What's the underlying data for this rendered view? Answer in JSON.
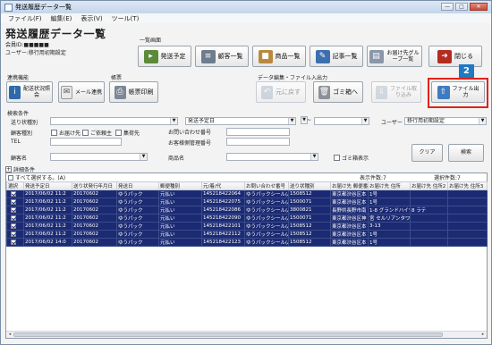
{
  "window": {
    "title": "発送履歴データ一覧",
    "controls": [
      "—",
      "□",
      "✕"
    ]
  },
  "menu": [
    "ファイル(F)",
    "編集(E)",
    "表示(V)",
    "ツール(T)"
  ],
  "page": {
    "title": "発送履歴データ一覧",
    "member_id": "会員ID:■■■■■",
    "user": "ユーザー:移行用初期設定"
  },
  "groups": {
    "ichiran": "一覧画面",
    "renkei": "連携機能",
    "chohyo": "帳票",
    "data_edit": "データ編集・ファイル入出力",
    "kensaku": "検索条件"
  },
  "buttons": {
    "hasso_yotei": "発送予定",
    "kokyaku": "顧客一覧",
    "shohin": "商品一覧",
    "kiji": "記事一覧",
    "otodoke_group": "お届け先グループ一覧",
    "close": "閉じる",
    "haisou_joukyou": "配送状況照会",
    "mail_renkei": "メール連携",
    "chohyo_insatsu": "帳票印刷",
    "moto_ni_modosu": "元に戻す",
    "gomibako": "ゴミ箱へ",
    "file_torikomi": "ファイル取り込み",
    "file_shutsuryoku": "ファイル出力",
    "clear": "クリア",
    "search": "検索"
  },
  "badge": "2",
  "search": {
    "okurijo_label": "送り状種別",
    "okurijo_value": "",
    "date_type_value": "発送予定日",
    "date_sep": "~",
    "user_label": "ユーザー",
    "user_value": "移行用初期設定",
    "kokyaku_shubetsu_label": "顧客種別",
    "chk_otodoke": "お届け先",
    "chk_irainushi": "ご依頼主",
    "chk_shuka": "集荷先",
    "toiawase_label": "お問い合わせ番号",
    "kokyaku_kanri_label": "お客様側管理番号",
    "tel_label": "TEL",
    "kokyakumei_label": "顧客名",
    "shohinmei_label": "商品名",
    "gomibako_hyoji": "ゴミ箱表示"
  },
  "detail_toggle": "詳細条件",
  "list": {
    "select_all": "すべて選択する。(A)",
    "display_count": "表示件数:7",
    "selected_count": "選択件数:7",
    "columns": [
      "選択",
      "発送予定日",
      "送り状発行年月日",
      "発送日",
      "郵便種別",
      "元/着/代",
      "お問い合わせ番号",
      "送り状種別",
      "お届け先 郵便番号",
      "お届け先 住所",
      "お届け先 住所2",
      "お届け先 住所3"
    ],
    "rows": [
      [
        "",
        "2017/06/02 11:2",
        "20170602",
        "ゆうパック",
        "元払い",
        "145218422064",
        "ゆうパックシール(A",
        "1508512",
        "東京都渋谷区本",
        "1号",
        "",
        ""
      ],
      [
        "",
        "2017/06/02 11:2",
        "20170602",
        "ゆうパック",
        "元払い",
        "145218422075",
        "ゆうパックシール(A",
        "1500071",
        "東京都渋谷区本",
        "1号",
        "",
        ""
      ],
      [
        "",
        "2017/06/02 11:2",
        "20170602",
        "ゆうパック",
        "元払い",
        "145218422086",
        "ゆうパックシール(A",
        "3800821",
        "長野県長野市南",
        "1-8 グランドハイツ",
        "8 ラテ",
        ""
      ],
      [
        "",
        "2017/06/02 11:2",
        "20170602",
        "ゆうパック",
        "元払い",
        "145218422090",
        "ゆうパックシール(A",
        "1500071",
        "東京都渋谷区神",
        "宮 セルリアンタワー",
        "",
        ""
      ],
      [
        "",
        "2017/06/02 11:2",
        "20170602",
        "ゆうパック",
        "元払い",
        "145218422101",
        "ゆうパックシール(A",
        "1508512",
        "東京都渋谷区本",
        "3-13",
        "",
        ""
      ],
      [
        "",
        "2017/06/02 11:2",
        "20170602",
        "ゆうパック",
        "元払い",
        "145218422112",
        "ゆうパックシール(A",
        "1508512",
        "東京都渋谷区本",
        "1号",
        "",
        ""
      ],
      [
        "",
        "2017/06/02 14:0",
        "20170602",
        "ゆうパック",
        "元払い",
        "145218422123",
        "ゆうパックシール(A",
        "1508512",
        "東京都渋谷区本",
        "1号",
        "",
        ""
      ]
    ]
  },
  "colors": {
    "accent_red": "#e0231a",
    "badge_blue": "#1f79c4",
    "row_selected": "#1c2a73"
  },
  "icons": {
    "hasso_yotei": "truck-icon",
    "kokyaku": "person-list-icon",
    "shohin": "box-icon",
    "kiji": "notebook-icon",
    "otodoke_group": "document-icon",
    "close": "exit-door-icon",
    "haisou_joukyou": "status-icon",
    "mail_renkei": "envelope-icon",
    "chohyo_insatsu": "printer-icon",
    "moto_ni_modosu": "undo-icon",
    "gomibako": "trash-icon",
    "file_torikomi": "file-import-icon",
    "file_shutsuryoku": "file-export-icon"
  }
}
